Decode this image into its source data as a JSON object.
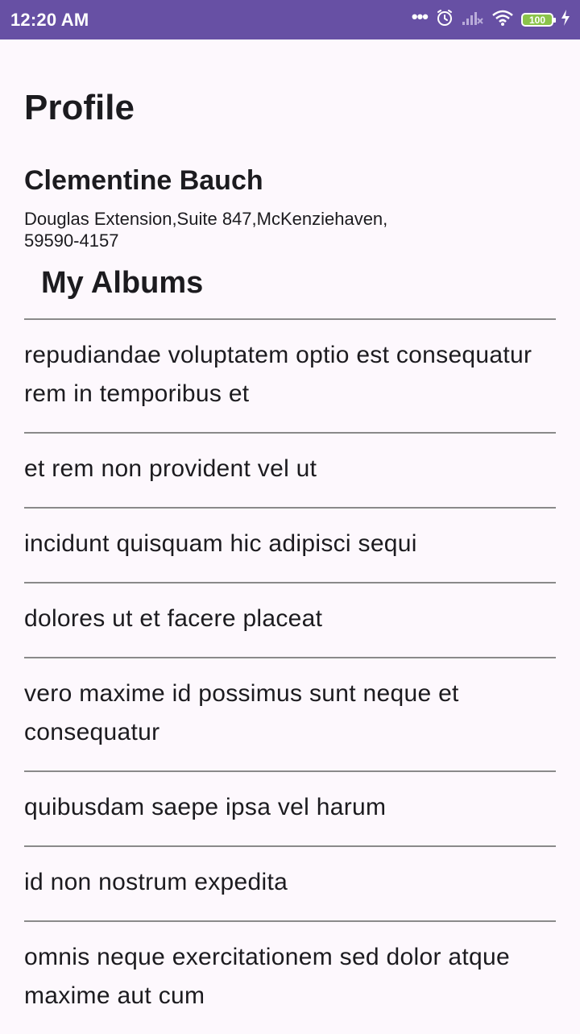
{
  "status_bar": {
    "time": "12:20 AM",
    "battery": "100",
    "icons": [
      "more-dots-icon",
      "alarm-icon",
      "signal-icon",
      "wifi-icon",
      "battery-icon",
      "charging-icon"
    ]
  },
  "profile": {
    "title": "Profile",
    "name": "Clementine Bauch",
    "address": "Douglas Extension,Suite 847,McKenziehaven, 59590-4157"
  },
  "albums": {
    "title": "My Albums",
    "items": [
      "repudiandae voluptatem optio est consequatur rem in temporibus et",
      "et rem non provident vel ut",
      "incidunt quisquam hic adipisci sequi",
      "dolores ut et facere placeat",
      "vero maxime id possimus sunt neque et consequatur",
      "quibusdam saepe ipsa vel harum",
      "id non nostrum expedita",
      "omnis neque exercitationem sed dolor atque maxime aut cum"
    ]
  },
  "colors": {
    "status_bar": "#6750a4",
    "background": "#fdf8fd",
    "divider": "#8a8a8a",
    "battery_fill": "#8bc34a"
  }
}
